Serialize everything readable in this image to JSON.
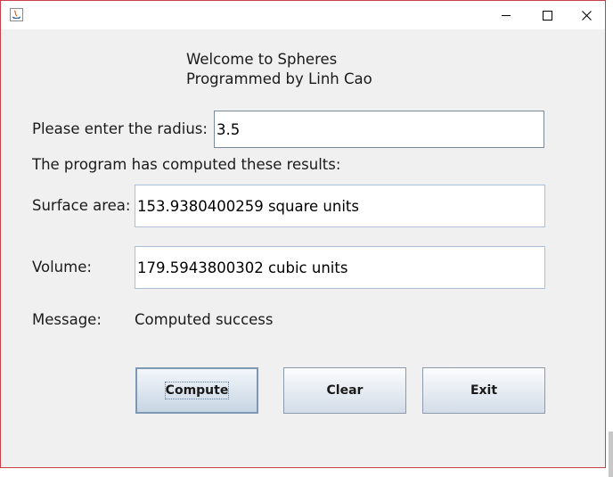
{
  "window": {
    "controls": {
      "minimize_glyph": "–",
      "maximize_glyph": "☐",
      "close_glyph": "✕"
    }
  },
  "welcome": {
    "line1": "Welcome to Spheres",
    "line2": "Programmed by Linh Cao"
  },
  "form": {
    "radius_label": "Please enter the radius:",
    "radius_value": "3.5",
    "results_header": "The program has computed these results:",
    "surface_label": "Surface area:",
    "surface_value": "153.9380400259 square units",
    "volume_label": "Volume:",
    "volume_value": "179.5943800302 cubic units",
    "message_label": "Message:",
    "message_value": "Computed success"
  },
  "buttons": {
    "compute": "Compute",
    "clear": "Clear",
    "exit": "Exit"
  },
  "colors": {
    "window_border": "#c7404a",
    "window_bg": "#f0f0f0",
    "field_border": "#a9c0d8"
  }
}
